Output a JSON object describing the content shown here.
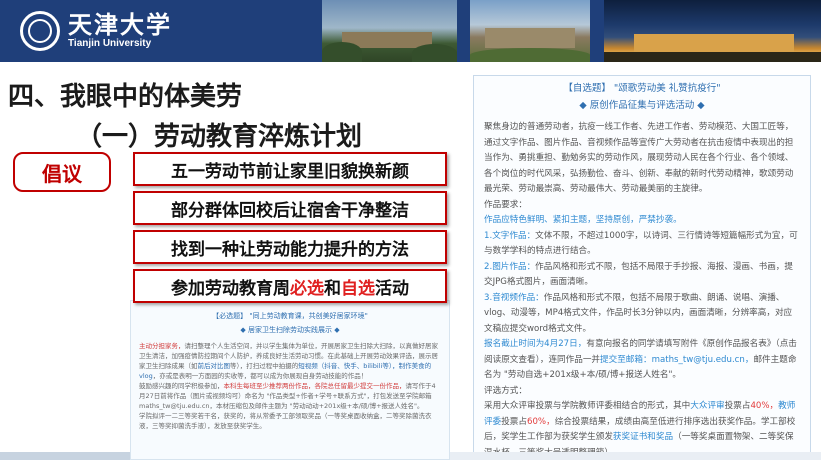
{
  "header": {
    "logo_cn": "天津大学",
    "logo_en": "Tianjin University"
  },
  "titles": {
    "main": "四、我眼中的体美劳",
    "sub": "（一）劳动教育淬炼计划"
  },
  "badge": "倡议",
  "plans": [
    {
      "text": "五一劳动节前让家里旧貌换新颜"
    },
    {
      "text": "部分群体回校后让宿舍干净整洁"
    },
    {
      "text": "找到一种让劳动能力提升的方法"
    },
    {
      "pre": "参加劳动教育周",
      "hl1": "必选",
      "mid": "和",
      "hl2": "自选",
      "post": "活动"
    }
  ],
  "doc_left": {
    "head": "【必选题】 \"同上劳动教育课，共创美好居家环境\"",
    "sub": "◆ 居家卫生扫除劳动实践展示 ◆",
    "p1a": "主动分担家务，",
    "p1b": "请扫整理个人生活空间，并以学生集体为单位，开展居家卫生扫除大扫除，以真做好居家卫生清洁，加强疫情防控期间个人防护，养成良好生活劳动习惯。在此基础上开展劳动效果评选，展示居家卫生扫除成果（如",
    "p1c": "前后对比图",
    "p1d": "等），打扫过程中拍摄的",
    "p1e": "短视频（抖音、快手、bilibili等），制作美食的vlog",
    "p1f": "，亦或是表明一方面园的实收等，都可以成为你展现自身劳动技能的作品！",
    "p2a": "鼓励感兴趣的同学积极参加，",
    "p2b": "本科生每班至少推荐两份作品，各院总任留最少提交一份作品，",
    "p2c": "请写作于4月27日前将作品（图片或视频均可）命名为 \"作品类型+作者+学号+联系方式\"，打包发送至学院邮箱maths_tw@tju.edu.cn，本材压缩包及邮件主题为 \"劳动动动+201x级+本/硕/博+报送人姓名\"。",
    "p3": "学院拟评一二三等奖若干名，获奖的，将从常委予工部领取奖品（一等奖桌面收纳盒，二等奖除菌洗衣液，三等奖抑菌洗手液），发放至获奖学生。"
  },
  "doc": {
    "head": "【自选题】 \"颂歌劳动美 礼赞抗疫行\"",
    "sub": "◆ 原创作品征集与评选活动 ◆",
    "intro": "聚焦身边的普通劳动者，抗疫一线工作者、先进工作者、劳动模范、大国工匠等，通过文字作品、图片作品、音视频作品等宣传广大劳动者在抗击疫情中表现出的担当作为、勇挑重担、勤勉务实的劳动作风，展现劳动人民在各个行业、各个领域、各个岗位的时代风采，弘扬勤俭、奋斗、创新、奉献的新时代劳动精神，歌颂劳动最光荣、劳动最崇高、劳动最伟大、劳动最美丽的主旋律。",
    "req_label": "作品要求：",
    "req_blue": "作品应特色鲜明、紧扣主题，坚持原创，严禁抄袭。",
    "t1_label": "1.文字作品：",
    "t1": "文体不限，不超过1000字，以诗词、三行情诗等短篇幅形式为宜，可与数学学科的特点进行结合。",
    "t2_label": "2.图片作品：",
    "t2": "作品风格和形式不限，包括不局限于手抄报、海报、漫画、书画，提交JPG格式图片，画面清晰。",
    "t3_label": "3.音视频作品：",
    "t3": "作品风格和形式不限，包括不局限于歌曲、朗诵、说唱、演播、vlog、动漫等，MP4格式文件，作品时长3分钟以内，画面清晰，分辨率高，对应文稿应提交word格式文件。",
    "deadline_label": "报名截止时间为4月27日，",
    "deadline": "有意向报名的同学请填写附件《原创作品报名表》（点击阅读原文查看），连同作品一并",
    "email_label": "提交至邮箱：",
    "email": "maths_tw@tju.edu.cn，",
    "deadline_tail": "邮件主题命名为 \"劳动自选+201x级+本/硕/博+报送人姓名\"。",
    "eval_label": "评选方式：",
    "eval1": "采用大众评审投票与学院教师评委相结合的形式，其中",
    "eval_pub": "大众评审",
    "eval2": "投票占",
    "eval_40": "40%，",
    "eval_teacher": "教师评委",
    "eval3": "投票占",
    "eval_60": "60%，",
    "eval4": "综合投票结果，成绩由高至低进行排序选出获奖作品。学工部校后，奖学生工作部为获奖学生颁发",
    "eval_cert": "获奖证书和奖品",
    "eval5": "（一等奖桌面置物架、二等奖保温水杯、三等奖大号透明整理箱）。"
  }
}
